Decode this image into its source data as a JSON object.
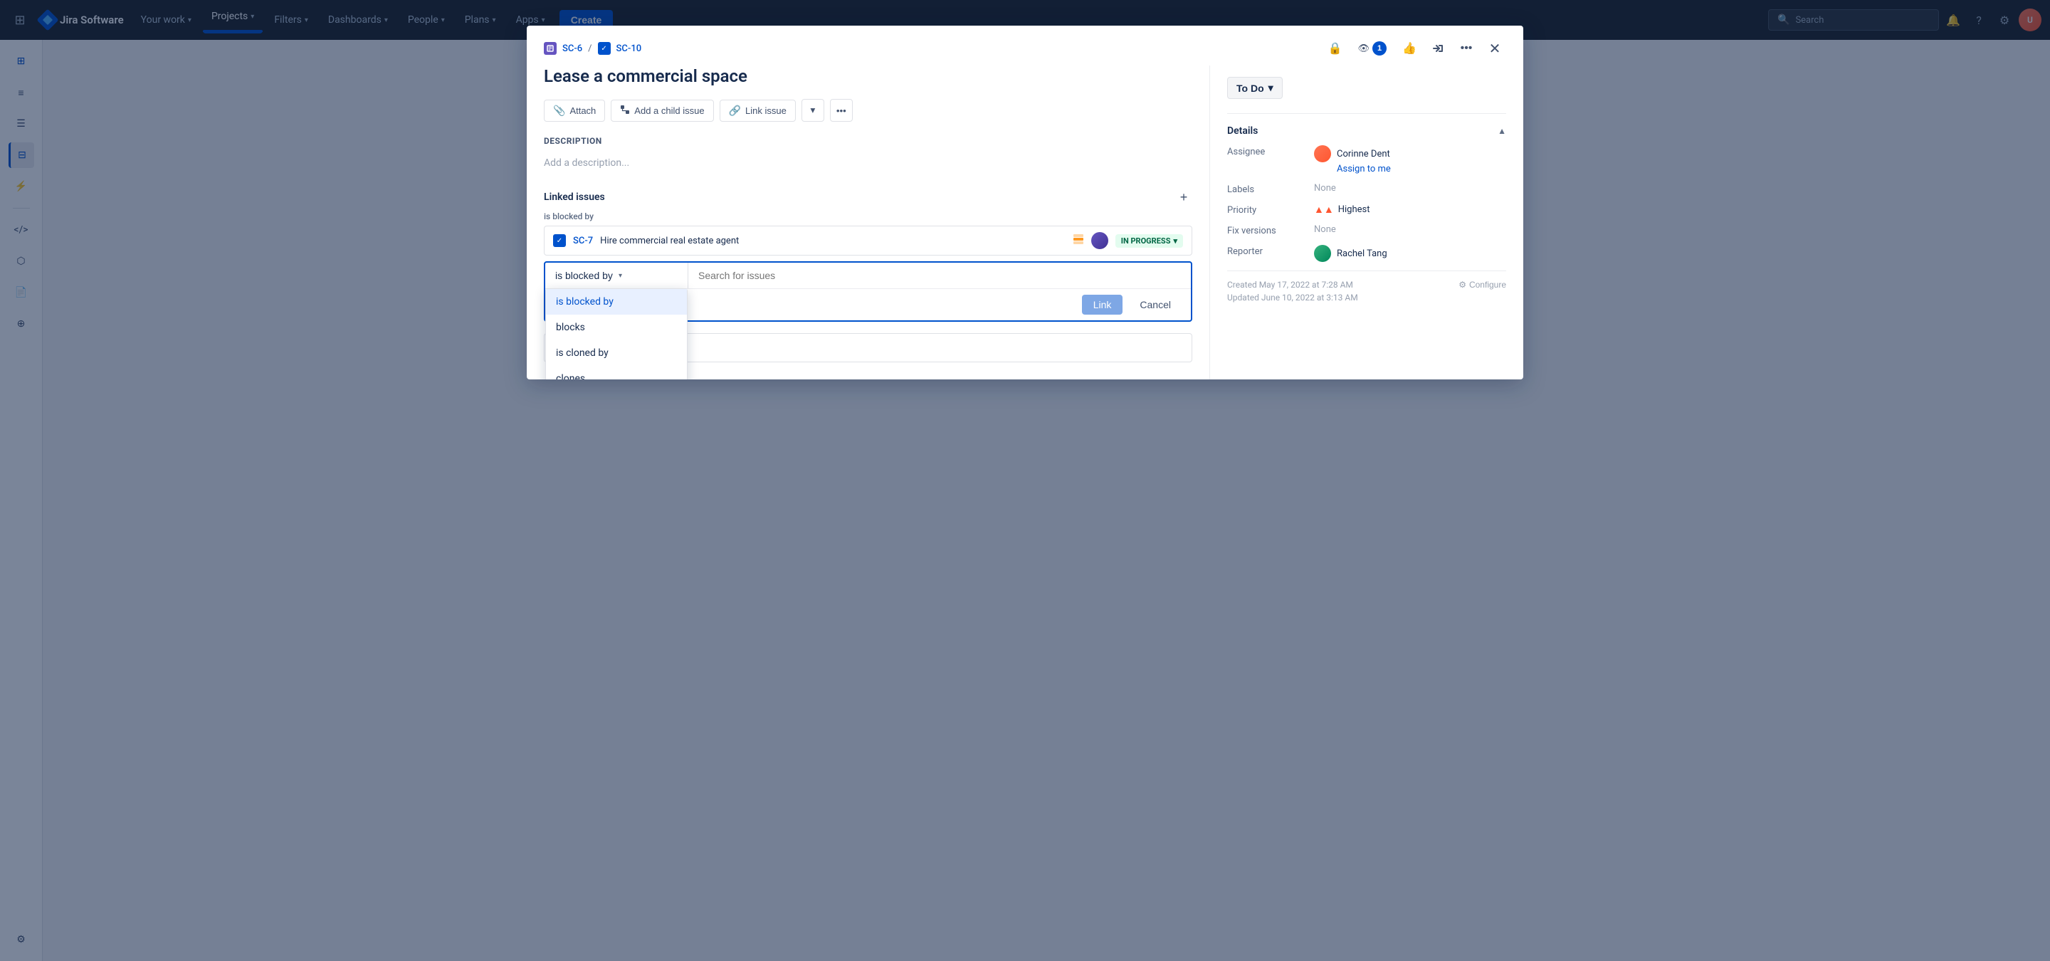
{
  "app": {
    "name": "Jira Software",
    "logo_text": "Jira Software"
  },
  "topnav": {
    "grid_icon": "⊞",
    "items": [
      {
        "id": "your-work",
        "label": "Your work",
        "chevron": true
      },
      {
        "id": "projects",
        "label": "Projects",
        "active": true,
        "chevron": true
      },
      {
        "id": "filters",
        "label": "Filters",
        "chevron": true
      },
      {
        "id": "dashboards",
        "label": "Dashboards",
        "chevron": true
      },
      {
        "id": "people",
        "label": "People",
        "chevron": true
      },
      {
        "id": "plans",
        "label": "Plans",
        "chevron": true
      },
      {
        "id": "apps",
        "label": "Apps",
        "chevron": true
      }
    ],
    "create_label": "Create",
    "search_placeholder": "Search"
  },
  "modal": {
    "breadcrumb": {
      "parent_key": "SC-6",
      "parent_type": "story",
      "child_key": "SC-10",
      "child_type": "task"
    },
    "title": "Lease a commercial space",
    "toolbar": {
      "attach_label": "Attach",
      "add_child_label": "Add a child issue",
      "link_issue_label": "Link issue",
      "more_icon": "•••"
    },
    "description": {
      "label": "Description",
      "placeholder": "Add a description..."
    },
    "linked_issues": {
      "title": "Linked issues",
      "is_blocked_by_label": "is blocked by",
      "linked_issue": {
        "key": "SC-7",
        "summary": "Hire commercial real estate agent",
        "priority": "medium",
        "status": "IN PROGRESS",
        "has_avatar": true
      }
    },
    "link_form": {
      "type_label": "is blocked by",
      "search_placeholder": "Search for issues",
      "link_btn": "Link",
      "cancel_btn": "Cancel",
      "dropdown_options": [
        {
          "id": "is-blocked-by",
          "label": "is blocked by",
          "selected": true
        },
        {
          "id": "blocks",
          "label": "blocks"
        },
        {
          "id": "is-cloned-by",
          "label": "is cloned by"
        },
        {
          "id": "clones",
          "label": "clones"
        }
      ]
    },
    "status": {
      "label": "To Do",
      "chevron": "▾"
    },
    "details": {
      "title": "Details",
      "chevron_up": "▲",
      "fields": {
        "assignee_label": "Assignee",
        "assignee_name": "Corinne Dent",
        "assign_to_me": "Assign to me",
        "labels_label": "Labels",
        "labels_value": "None",
        "priority_label": "Priority",
        "priority_value": "Highest",
        "fix_versions_label": "Fix versions",
        "fix_versions_value": "None",
        "reporter_label": "Reporter",
        "reporter_name": "Rachel Tang"
      }
    },
    "metadata": {
      "created": "Created May 17, 2022 at 7:28 AM",
      "updated": "Updated June 10, 2022 at 3:13 AM",
      "configure_label": "Configure"
    },
    "action_icons": {
      "lock": "🔒",
      "watch_count": "1",
      "thumbsup": "👍",
      "share": "↗",
      "more": "•••",
      "close": "✕"
    }
  }
}
